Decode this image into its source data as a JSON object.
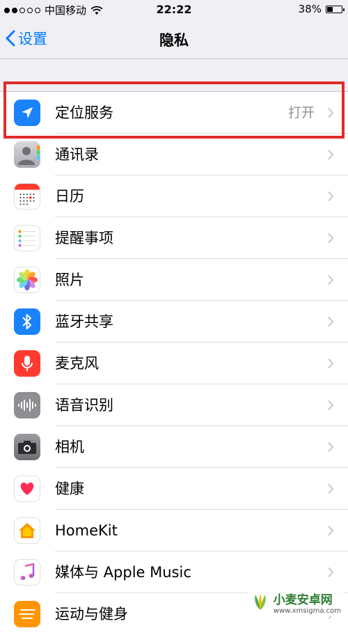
{
  "status_bar": {
    "carrier": "中国移动",
    "time": "22:22",
    "battery": "38%",
    "battery_level": 0.38
  },
  "nav": {
    "back_label": "设置",
    "title": "隐私"
  },
  "rows": [
    {
      "label": "定位服务",
      "value": "打开",
      "icon": "location-arrow-icon"
    },
    {
      "label": "通讯录",
      "icon": "contacts-icon"
    },
    {
      "label": "日历",
      "icon": "calendar-icon"
    },
    {
      "label": "提醒事项",
      "icon": "reminders-icon"
    },
    {
      "label": "照片",
      "icon": "photos-icon"
    },
    {
      "label": "蓝牙共享",
      "icon": "bluetooth-icon"
    },
    {
      "label": "麦克风",
      "icon": "microphone-icon"
    },
    {
      "label": "语音识别",
      "icon": "speech-recognition-icon"
    },
    {
      "label": "相机",
      "icon": "camera-icon"
    },
    {
      "label": "健康",
      "icon": "health-heart-icon"
    },
    {
      "label": "HomeKit",
      "icon": "homekit-house-icon"
    },
    {
      "label": "媒体与 Apple Music",
      "icon": "music-note-icon"
    },
    {
      "label": "运动与健身",
      "icon": "motion-fitness-icon"
    }
  ],
  "colors": {
    "accent": "#007aff",
    "highlight": "#e02b2b"
  },
  "watermark": {
    "title": "小麦安卓网",
    "url": "www.xmsigma.com"
  }
}
